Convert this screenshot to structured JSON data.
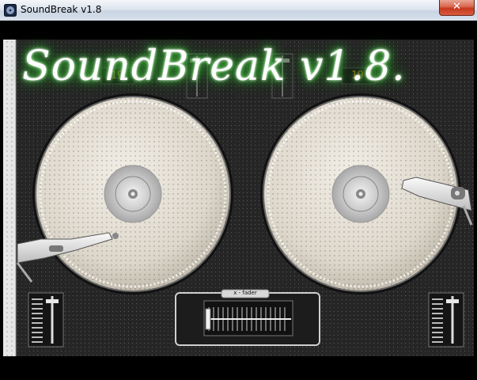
{
  "window": {
    "title": "SoundBreak v1.8",
    "close_glyph": "✕",
    "app_icon": "soundbreak-app-icon"
  },
  "logo": {
    "text": "SoundBreak v1.8."
  },
  "decks": {
    "left_counter": "19",
    "right_counter": "19"
  },
  "mixer": {
    "crossfader_label": "x - fader"
  },
  "colors": {
    "background": "#000000",
    "panel": "#252525",
    "platter": "#ddd7cb",
    "logo_glow": "#3fcf3a",
    "counter": "#d97e1c",
    "close_button": "#c6381d"
  }
}
